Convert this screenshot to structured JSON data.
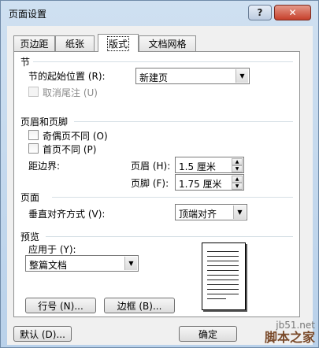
{
  "window": {
    "title": "页面设置"
  },
  "titlebar": {
    "help_label": "?",
    "close_label": "✕"
  },
  "tabs": [
    {
      "label": "页边距"
    },
    {
      "label": "纸张"
    },
    {
      "label": "版式"
    },
    {
      "label": "文档网格"
    }
  ],
  "section": {
    "heading": "节",
    "start_label": "节的起始位置 (R):",
    "start_value": "新建页",
    "suppress_endnotes_label": "取消尾注 (U)"
  },
  "header_footer": {
    "heading": "页眉和页脚",
    "odd_even_label": "奇偶页不同 (O)",
    "first_page_label": "首页不同 (P)",
    "from_edge_label": "距边界:",
    "header_label": "页眉 (H):",
    "header_value": "1.5 厘米",
    "footer_label": "页脚 (F):",
    "footer_value": "1.75 厘米"
  },
  "page": {
    "heading": "页面",
    "vertical_align_label": "垂直对齐方式 (V):",
    "vertical_align_value": "顶端对齐"
  },
  "preview": {
    "heading": "预览",
    "apply_to_label": "应用于 (Y):",
    "apply_to_value": "整篇文档"
  },
  "buttons": {
    "line_numbers": "行号 (N)...",
    "borders": "边框 (B)...",
    "default": "默认 (D)...",
    "ok": "确定"
  },
  "watermark": {
    "line1": "jb51.net",
    "line2": "脚本之家"
  }
}
